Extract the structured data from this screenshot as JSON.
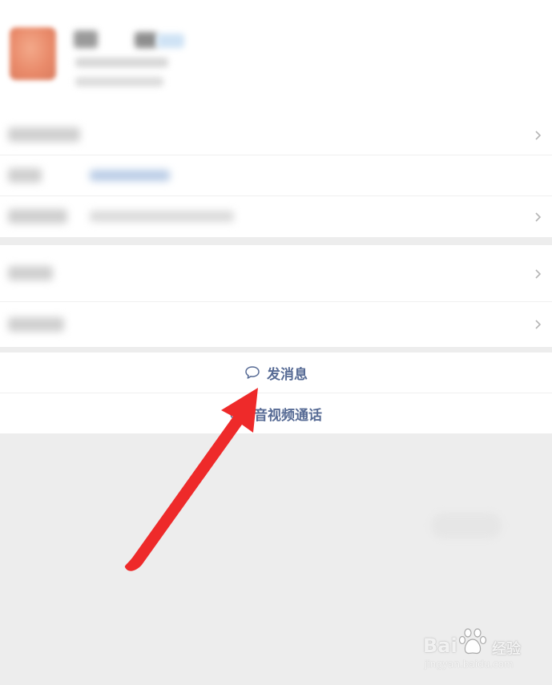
{
  "actions": {
    "send_message": {
      "label": "发消息",
      "icon": "chat-bubble-icon"
    },
    "video_call": {
      "label": "音视频通话",
      "icon": "video-call-icon"
    }
  },
  "watermark": {
    "brand": "Bai",
    "brand_cn": "经验",
    "url": "jingyan.baidu.com"
  },
  "colors": {
    "link_blue": "#576b95",
    "annotation_red": "#ee2a2a",
    "background": "#ededed",
    "panel": "#ffffff"
  }
}
